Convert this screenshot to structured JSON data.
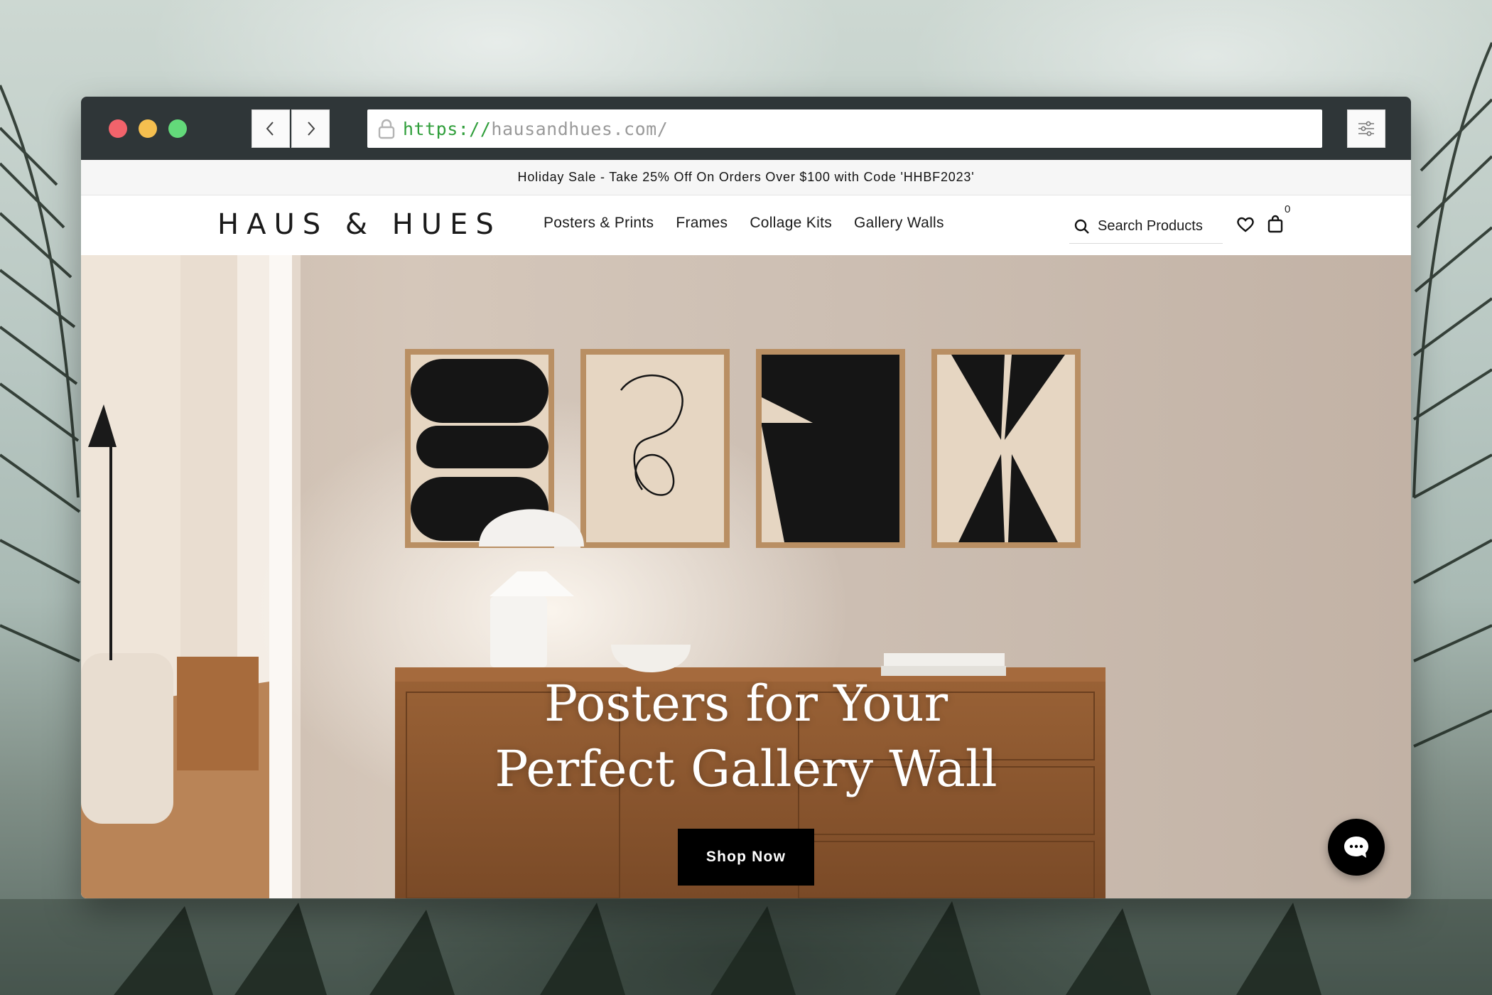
{
  "browser": {
    "url_protocol": "https://",
    "url_domain": "hausandhues.com/"
  },
  "announcement": "Holiday Sale - Take 25% Off On Orders Over $100 with Code 'HHBF2023'",
  "header": {
    "logo": "HAUS & HUES",
    "nav": [
      "Posters & Prints",
      "Frames",
      "Collage Kits",
      "Gallery Walls"
    ],
    "search_label": "Search Products",
    "cart_count": "0"
  },
  "hero": {
    "title_line1": "Posters for Your",
    "title_line2": "Perfect Gallery Wall",
    "cta": "Shop Now"
  },
  "icons": {
    "lock": "lock-icon",
    "back": "chevron-left-icon",
    "forward": "chevron-right-icon",
    "menu": "sliders-icon",
    "search": "search-icon",
    "wishlist": "heart-icon",
    "cart": "shopping-bag-icon",
    "chat": "chat-bubble-icon"
  },
  "colors": {
    "chrome": "#2f3638",
    "url_protocol": "#2f9e3a",
    "cta_background": "#000000",
    "cta_text": "#ffffff"
  }
}
